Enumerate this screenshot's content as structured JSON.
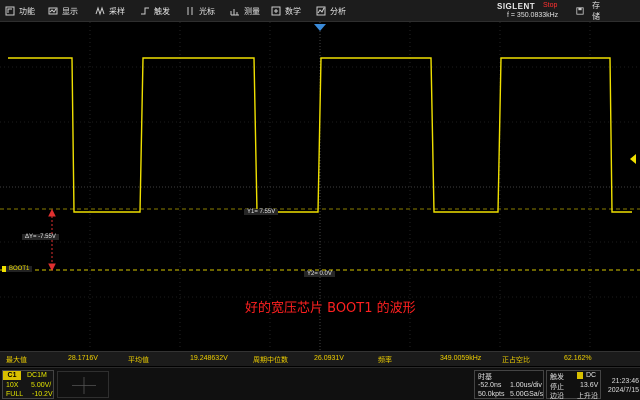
{
  "menu": {
    "items": [
      {
        "label": "功能",
        "icon": "function-icon"
      },
      {
        "label": "显示",
        "icon": "display-icon"
      },
      {
        "label": "采样",
        "icon": "acquire-icon"
      },
      {
        "label": "触发",
        "icon": "trigger-icon"
      },
      {
        "label": "光标",
        "icon": "cursor-icon"
      },
      {
        "label": "测量",
        "icon": "measure-icon"
      },
      {
        "label": "数学",
        "icon": "math-icon"
      },
      {
        "label": "分析",
        "icon": "analyze-icon"
      }
    ],
    "brand": "SIGLENT",
    "run_state": "Stop",
    "frequency": "f = 350.0833kHz",
    "save_label": "存储"
  },
  "cursors": {
    "y1_label": "Y1= 7.55V",
    "y2_label": "Y2= 0.0V",
    "delta_label": "ΔY= -7.55V",
    "channel_marker": "BOOT1"
  },
  "annotation": "好的宽压芯片 BOOT1 的波形",
  "measurements": [
    {
      "name": "最大值",
      "value": "28.1716V"
    },
    {
      "name": "平均值",
      "value": "19.248632V"
    },
    {
      "name": "周期中位数",
      "value": "26.0931V"
    },
    {
      "name": "频率",
      "value": "349.0059kHz"
    },
    {
      "name": "正占空比",
      "value": "62.162%"
    }
  ],
  "channel": {
    "name": "C1",
    "coupling": "DC1M",
    "probe": "10X",
    "scale": "5.00V/",
    "bandwidth": "FULL",
    "offset": "-10.2V"
  },
  "timebase": {
    "title": "时基",
    "delay": "-52.0ns",
    "scale": "1.00us/div",
    "points": "50.0kpts",
    "rate": "5.00GSa/s"
  },
  "trigger": {
    "title": "触发",
    "coupling": "DC",
    "mode": "停止",
    "level": "13.6V",
    "type": "边沿",
    "slope": "上升沿"
  },
  "clock": {
    "time": "21:23:46",
    "date": "2024/7/15"
  },
  "colors": {
    "trace": "#f0e000",
    "cursor": "#d8c800",
    "annotation": "#ff2020",
    "grid": "#3a3a3a"
  }
}
